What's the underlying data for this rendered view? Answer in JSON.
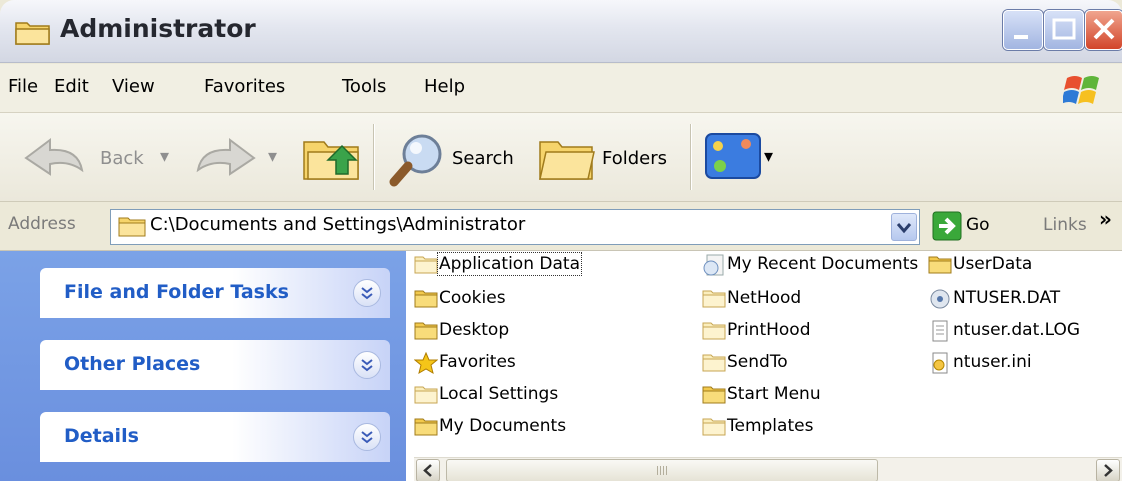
{
  "window": {
    "title": "Administrator",
    "buttons": [
      "minimize",
      "maximize",
      "close"
    ]
  },
  "menubar": {
    "items": [
      "File",
      "Edit",
      "View",
      "Favorites",
      "Tools",
      "Help"
    ]
  },
  "toolbar": {
    "back_label": "Back",
    "search_label": "Search",
    "folders_label": "Folders"
  },
  "address": {
    "label": "Address",
    "value": "C:\\Documents and Settings\\Administrator",
    "go_label": "Go",
    "links_label": "Links",
    "overflow": "»"
  },
  "tasks": {
    "panels": [
      "File and Folder Tasks",
      "Other Places",
      "Details"
    ]
  },
  "files": {
    "items": [
      {
        "name": "Application Data",
        "icon": "folder-faded-icon",
        "selected": true
      },
      {
        "name": "Cookies",
        "icon": "folder-icon"
      },
      {
        "name": "Desktop",
        "icon": "folder-icon"
      },
      {
        "name": "Favorites",
        "icon": "favorites-star-icon"
      },
      {
        "name": "Local Settings",
        "icon": "folder-faded-icon"
      },
      {
        "name": "My Documents",
        "icon": "folder-icon"
      },
      {
        "name": "My Recent Documents",
        "icon": "recent-documents-icon"
      },
      {
        "name": "NetHood",
        "icon": "folder-faded-icon"
      },
      {
        "name": "PrintHood",
        "icon": "folder-faded-icon"
      },
      {
        "name": "SendTo",
        "icon": "folder-faded-icon"
      },
      {
        "name": "Start Menu",
        "icon": "folder-icon"
      },
      {
        "name": "Templates",
        "icon": "folder-faded-icon"
      },
      {
        "name": "UserData",
        "icon": "folder-icon"
      },
      {
        "name": "NTUSER.DAT",
        "icon": "system-file-icon"
      },
      {
        "name": "ntuser.dat.LOG",
        "icon": "text-file-icon"
      },
      {
        "name": "ntuser.ini",
        "icon": "settings-file-icon"
      }
    ]
  },
  "colors": {
    "task_pane": "#7ba2e7",
    "panel_title": "#215dc6",
    "folder": "#f5d67a",
    "close_button": "#d2452a"
  }
}
